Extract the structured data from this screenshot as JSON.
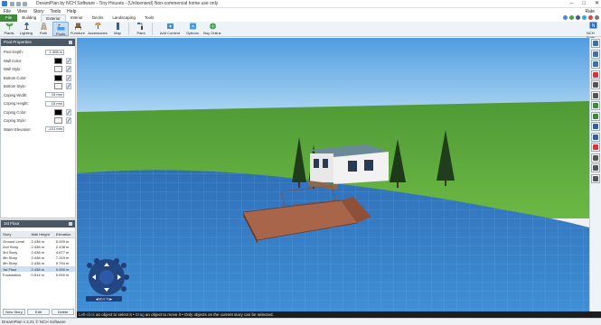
{
  "window": {
    "title": "DreamPlan by NCH Software - Tiny Houses - (Unlicensed) Non-commercial home use only"
  },
  "menu": {
    "items": [
      "File",
      "View",
      "Story",
      "Tools",
      "Help"
    ],
    "help_right": "Rate"
  },
  "ribbon": {
    "tabs": [
      "File",
      "Building",
      "Exterior",
      "Interior",
      "Decks",
      "Landscaping",
      "Tools"
    ],
    "active_tab": "Exterior"
  },
  "toolbar": {
    "plants": "Plants",
    "lighting": "Lighting",
    "path": "Path",
    "pools": "Pools",
    "furniture": "Furniture",
    "accessories": "Accessories",
    "map": "Map",
    "paint": "Paint",
    "add_content": "Add Content",
    "options": "Options",
    "buy_online": "Buy Online",
    "nch_suite": "NCH Suite"
  },
  "pool_properties": {
    "header": "Pool Properties",
    "rows": [
      {
        "label": "Pool Depth:",
        "value": "1.408 m",
        "kind": "text"
      },
      {
        "label": "Wall Color:",
        "kind": "color",
        "color": "#000000"
      },
      {
        "label": "Wall Style:",
        "kind": "color",
        "color": "#f4f4f4"
      },
      {
        "label": "Bottom Color:",
        "kind": "color",
        "color": "#000000"
      },
      {
        "label": "Bottom Style:",
        "kind": "color",
        "color": "#f4f4f4"
      },
      {
        "label": "Coping Width:",
        "value": "15 mm",
        "kind": "text"
      },
      {
        "label": "Coping Height:",
        "value": "15 mm",
        "kind": "text"
      },
      {
        "label": "Coping Color:",
        "kind": "color",
        "color": "#000000"
      },
      {
        "label": "Coping Style:",
        "kind": "color",
        "color": "#f4f4f4"
      },
      {
        "label": "Water Elevation:",
        "value": "-101 mm",
        "kind": "text"
      }
    ]
  },
  "floors": {
    "header": "1st Floor",
    "columns": [
      "Story",
      "Wall Height",
      "Elevation"
    ],
    "rows": [
      [
        "Ground Level",
        "2.438 m",
        "0.000 m"
      ],
      [
        "2nd Story",
        "2.438 m",
        "2.438 m"
      ],
      [
        "3rd Story",
        "2.438 m",
        "4.877 m"
      ],
      [
        "4th Story",
        "2.438 m",
        "7.315 m"
      ],
      [
        "5th Story",
        "2.438 m",
        "9.754 m"
      ],
      [
        "1st Floor",
        "2.438 m",
        "0.000 m"
      ],
      [
        "Foundation",
        "0.914 m",
        "0.000 m"
      ]
    ],
    "selected_row": 5,
    "buttons": [
      "New Story",
      "Edit",
      "Delete"
    ]
  },
  "navigator": {
    "zoom_readout": "◀ 80.0 % ▶"
  },
  "status": {
    "prefix_hl": "Left-click",
    "text1": " an object to select it • ",
    "drag_hl": "Drag",
    "text2": " an object to move it • Only objects on the current story can be selected."
  },
  "bottombar": {
    "version": "DreamPlan v 2.21 © NCH Software"
  },
  "colors": {
    "sky": "#6fb0e6",
    "grass": "#5da33a",
    "water": "#3a7fc4",
    "deck": "#b06a48",
    "panel_header": "#4a5866"
  }
}
